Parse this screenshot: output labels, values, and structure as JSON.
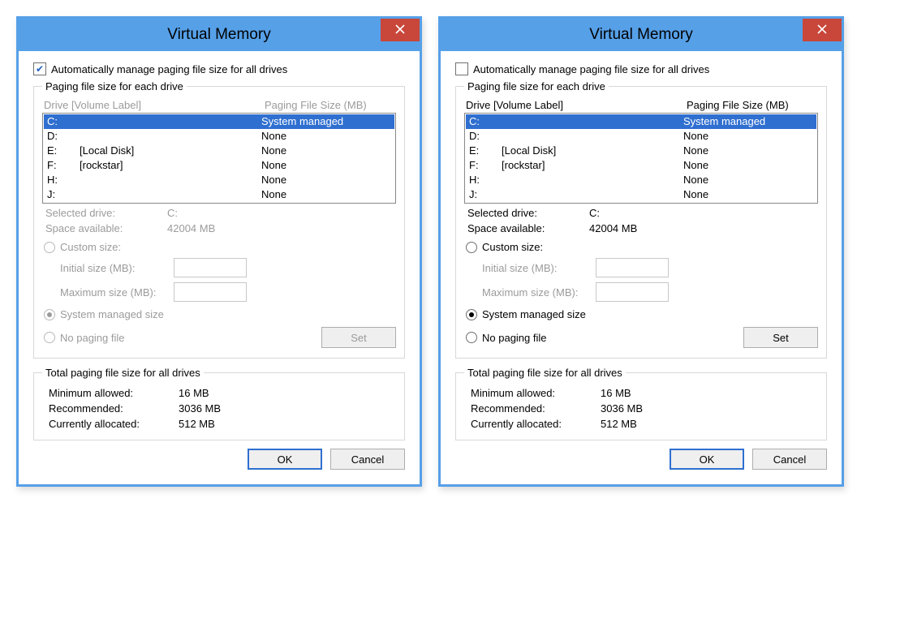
{
  "dialogs": [
    {
      "title": "Virtual Memory",
      "auto_manage_checked": true,
      "auto_manage_label": "Automatically manage paging file size for all drives",
      "section_disabled": true,
      "paging_legend": "Paging file size for each drive",
      "hdr_drive": "Drive  [Volume Label]",
      "hdr_size": "Paging File Size (MB)",
      "drives": [
        {
          "letter": "C:",
          "label": "",
          "size": "System managed",
          "selected": true
        },
        {
          "letter": "D:",
          "label": "",
          "size": "None",
          "selected": false
        },
        {
          "letter": "E:",
          "label": "[Local Disk]",
          "size": "None",
          "selected": false
        },
        {
          "letter": "F:",
          "label": "[rockstar]",
          "size": "None",
          "selected": false
        },
        {
          "letter": "H:",
          "label": "",
          "size": "None",
          "selected": false
        },
        {
          "letter": "J:",
          "label": "",
          "size": "None",
          "selected": false
        }
      ],
      "sel_drive_label": "Selected drive:",
      "sel_drive_value": "C:",
      "space_label": "Space available:",
      "space_value": "42004 MB",
      "custom_label": "Custom size:",
      "initial_label": "Initial size (MB):",
      "maximum_label": "Maximum size (MB):",
      "system_managed_label": "System managed size",
      "no_paging_label": "No paging file",
      "radio_selected": "system",
      "set_label": "Set",
      "totals_legend": "Total paging file size for all drives",
      "min_label": "Minimum allowed:",
      "min_value": "16 MB",
      "rec_label": "Recommended:",
      "rec_value": "3036 MB",
      "cur_label": "Currently allocated:",
      "cur_value": "512 MB",
      "ok_label": "OK",
      "cancel_label": "Cancel"
    },
    {
      "title": "Virtual Memory",
      "auto_manage_checked": false,
      "auto_manage_label": "Automatically manage paging file size for all drives",
      "section_disabled": false,
      "paging_legend": "Paging file size for each drive",
      "hdr_drive": "Drive  [Volume Label]",
      "hdr_size": "Paging File Size (MB)",
      "drives": [
        {
          "letter": "C:",
          "label": "",
          "size": "System managed",
          "selected": true
        },
        {
          "letter": "D:",
          "label": "",
          "size": "None",
          "selected": false
        },
        {
          "letter": "E:",
          "label": "[Local Disk]",
          "size": "None",
          "selected": false
        },
        {
          "letter": "F:",
          "label": "[rockstar]",
          "size": "None",
          "selected": false
        },
        {
          "letter": "H:",
          "label": "",
          "size": "None",
          "selected": false
        },
        {
          "letter": "J:",
          "label": "",
          "size": "None",
          "selected": false
        }
      ],
      "sel_drive_label": "Selected drive:",
      "sel_drive_value": "C:",
      "space_label": "Space available:",
      "space_value": "42004 MB",
      "custom_label": "Custom size:",
      "initial_label": "Initial size (MB):",
      "maximum_label": "Maximum size (MB):",
      "system_managed_label": "System managed size",
      "no_paging_label": "No paging file",
      "radio_selected": "system",
      "set_label": "Set",
      "totals_legend": "Total paging file size for all drives",
      "min_label": "Minimum allowed:",
      "min_value": "16 MB",
      "rec_label": "Recommended:",
      "rec_value": "3036 MB",
      "cur_label": "Currently allocated:",
      "cur_value": "512 MB",
      "ok_label": "OK",
      "cancel_label": "Cancel"
    }
  ]
}
